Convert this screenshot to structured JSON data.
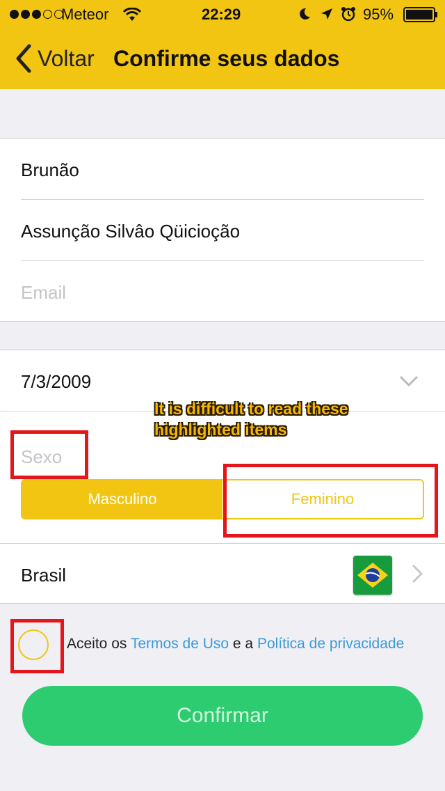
{
  "status_bar": {
    "carrier": "Meteor",
    "time": "22:29",
    "battery": "95%",
    "icons": [
      "signal-dots",
      "wifi-icon",
      "moon-icon",
      "location-icon",
      "alarm-icon",
      "battery-icon"
    ]
  },
  "nav": {
    "back_label": "Voltar",
    "title": "Confirme seus dados"
  },
  "form": {
    "first_name": "Brunão",
    "last_name": "Assunção Silvâo Qüicioção",
    "email_placeholder": "Email",
    "birth_date": "7/3/2009",
    "sex_label": "Sexo",
    "sex_options": [
      "Masculino",
      "Feminino"
    ],
    "sex_selected": "Masculino",
    "country": "Brasil"
  },
  "terms": {
    "prefix": "Aceito os",
    "terms_link": "Termos de Uso",
    "middle": "e a",
    "privacy_link": "Política de privacidade",
    "accepted": false
  },
  "confirm_button": "Confirmar",
  "annotation": {
    "line1": "It is difficult to read these",
    "line2": "highlighted items"
  },
  "colors": {
    "brand_yellow": "#f2c512",
    "confirm_green": "#2ecc71",
    "link_blue": "#3a9ad9",
    "highlight_red": "#e4161b"
  }
}
